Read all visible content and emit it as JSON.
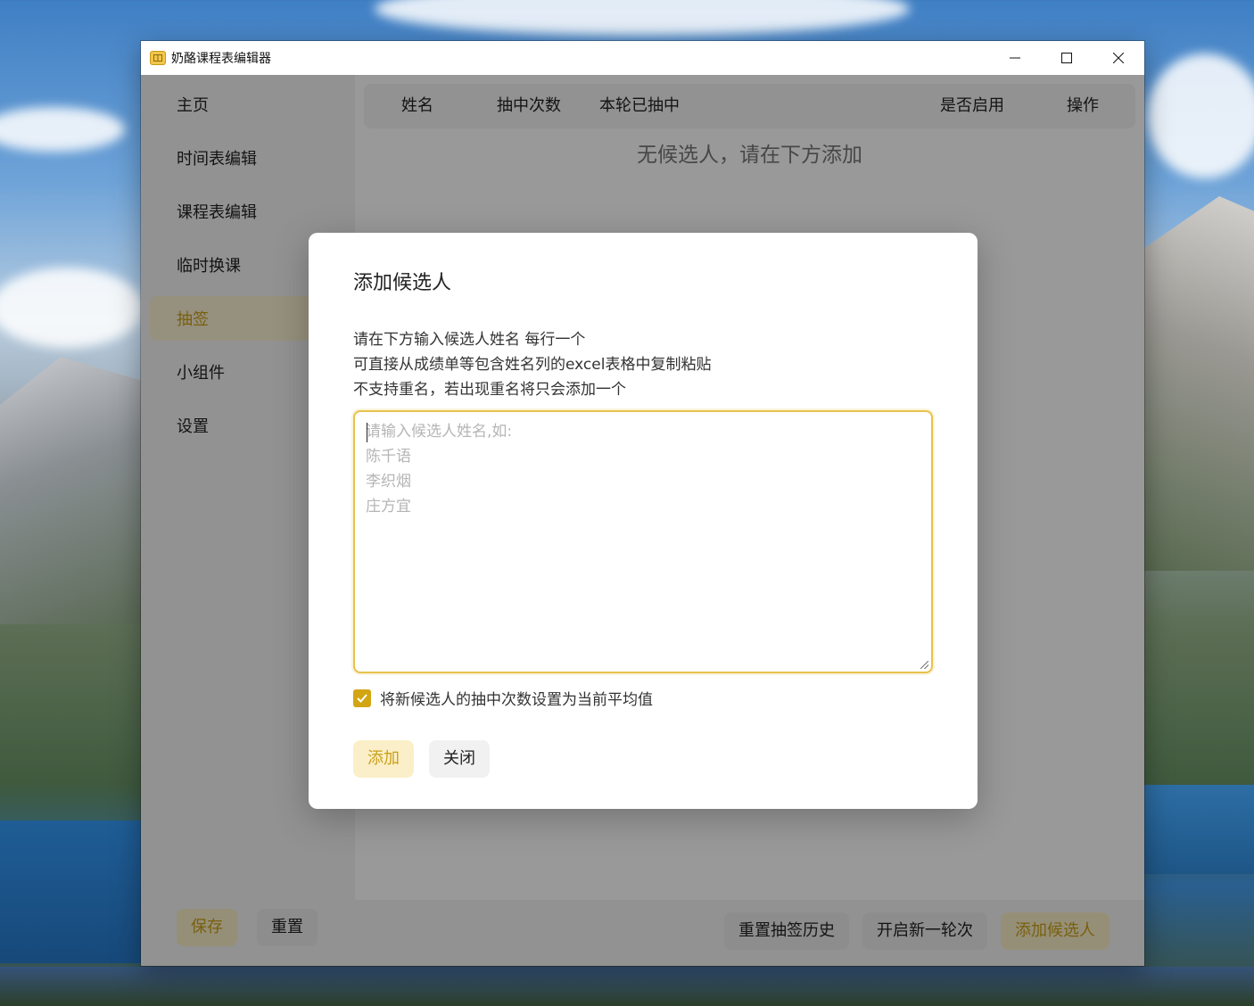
{
  "window": {
    "title": "奶酪课程表编辑器",
    "controls": {
      "minimize": "—",
      "maximize": "☐",
      "close": "✕"
    }
  },
  "sidebar": {
    "items": [
      {
        "label": "主页",
        "active": false
      },
      {
        "label": "时间表编辑",
        "active": false
      },
      {
        "label": "课程表编辑",
        "active": false
      },
      {
        "label": "临时换课",
        "active": false
      },
      {
        "label": "抽签",
        "active": true
      },
      {
        "label": "小组件",
        "active": false
      },
      {
        "label": "设置",
        "active": false
      }
    ],
    "save_label": "保存",
    "reset_label": "重置"
  },
  "table": {
    "columns": [
      "姓名",
      "抽中次数",
      "本轮已抽中",
      "是否启用",
      "操作"
    ],
    "empty_text": "无候选人，请在下方添加"
  },
  "bottombar": {
    "reset_history_label": "重置抽签历史",
    "new_round_label": "开启新一轮次",
    "add_candidate_label": "添加候选人"
  },
  "dialog": {
    "title": "添加候选人",
    "description": [
      "请在下方输入候选人姓名 每行一个",
      "可直接从成绩单等包含姓名列的excel表格中复制粘贴",
      "不支持重名，若出现重名将只会添加一个"
    ],
    "textarea_placeholder": "请输入候选人姓名,如:\n陈千语\n李织烟\n庄方宜",
    "checkbox_label": "将新候选人的抽中次数设置为当前平均值",
    "checkbox_checked": true,
    "add_label": "添加",
    "close_label": "关闭"
  },
  "colors": {
    "accent": "#c9a018",
    "accent_bg": "#fbefc9",
    "checkbox": "#d2a514"
  }
}
